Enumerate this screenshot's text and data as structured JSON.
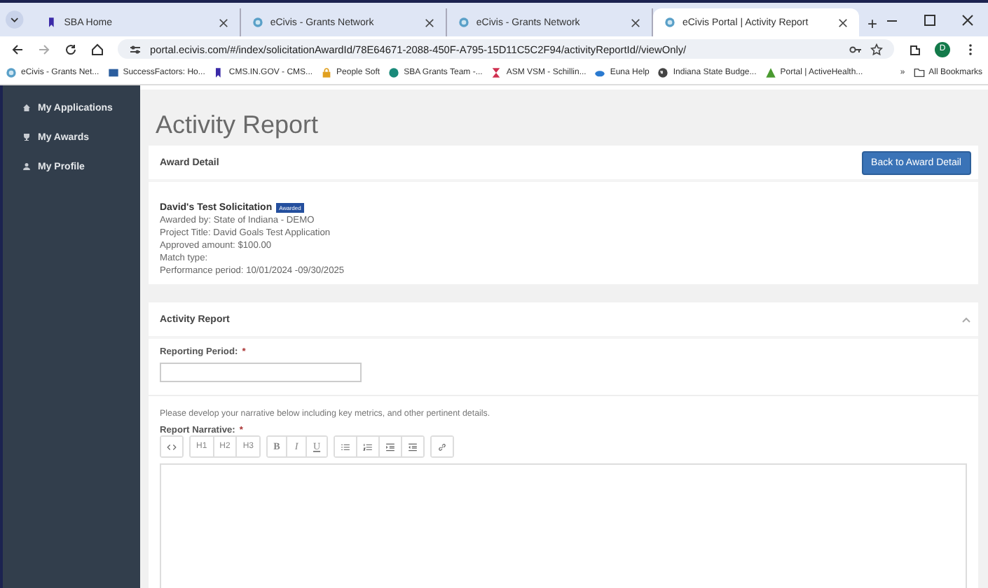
{
  "browser": {
    "tabs": [
      {
        "title": "SBA Home",
        "kind": "bookmark",
        "selected": false
      },
      {
        "title": "eCivis - Grants Network",
        "kind": "globe",
        "selected": false
      },
      {
        "title": "eCivis - Grants Network",
        "kind": "globe",
        "selected": false
      },
      {
        "title": "eCivis Portal | Activity Report",
        "kind": "globe",
        "selected": true
      }
    ],
    "new_tab": "+",
    "address": "portal.ecivis.com/#/index/solicitationAwardId/78E64671-2088-450F-A795-15D11C5C2F94/activityReportId//viewOnly/",
    "profile": "D",
    "bookmarks": [
      {
        "label": "eCivis - Grants Net...",
        "kind": "globe"
      },
      {
        "label": "SuccessFactors: Ho...",
        "kind": "square"
      },
      {
        "label": "CMS.IN.GOV - CMS...",
        "kind": "bookmark"
      },
      {
        "label": "People Soft",
        "kind": "lock"
      },
      {
        "label": "SBA Grants Team -...",
        "kind": "circle"
      },
      {
        "label": "ASM VSM - Schillin...",
        "kind": "hourglass"
      },
      {
        "label": "Euna Help",
        "kind": "cloud"
      },
      {
        "label": "Indiana State Budge...",
        "kind": "earth"
      },
      {
        "label": "Portal | ActiveHealth...",
        "kind": "triangle"
      }
    ],
    "more": "»",
    "all_bookmarks": "All Bookmarks"
  },
  "sidebar": {
    "items": [
      {
        "label": "My Applications",
        "kind": "home"
      },
      {
        "label": "My Awards",
        "kind": "trophy"
      },
      {
        "label": "My Profile",
        "kind": "user"
      }
    ]
  },
  "page": {
    "title": "Activity Report",
    "award_detail": {
      "heading": "Award Detail",
      "button": "Back to Award Detail",
      "solicitation": "David's Test Solicitation",
      "badge": "Awarded",
      "lines": [
        "Awarded by: State of Indiana - DEMO",
        "Project Title: David Goals Test Application",
        "Approved amount: $100.00",
        "Match type:",
        "Performance period: 10/01/2024 -09/30/2025"
      ]
    },
    "activity_report": {
      "heading": "Activity Report",
      "expanded": true,
      "reporting_period": {
        "label": "Reporting Period:",
        "required_mark": "*"
      },
      "hint": "Please develop your narrative below including key metrics, and other pertinent details.",
      "narrative": {
        "label": "Report Narrative:",
        "required_mark": "*"
      },
      "toolbar": [
        [
          {
            "kind": "code"
          }
        ],
        [
          {
            "kind": "text",
            "label": "H1"
          },
          {
            "kind": "text",
            "label": "H2"
          },
          {
            "kind": "text",
            "label": "H3"
          }
        ],
        [
          {
            "kind": "bold",
            "label": "B"
          },
          {
            "kind": "italic",
            "label": "I"
          },
          {
            "kind": "underline",
            "label": "U"
          }
        ],
        [
          {
            "kind": "bullets"
          },
          {
            "kind": "numbers"
          },
          {
            "kind": "indent"
          },
          {
            "kind": "outdent"
          }
        ],
        [
          {
            "kind": "link"
          }
        ]
      ]
    }
  }
}
